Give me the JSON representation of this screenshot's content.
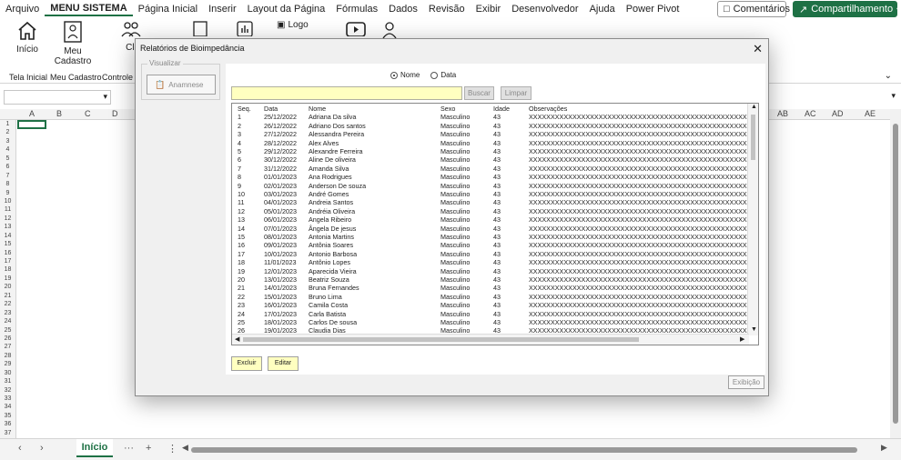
{
  "menu": [
    "Arquivo",
    "MENU SISTEMA",
    "Página Inicial",
    "Inserir",
    "Layout da Página",
    "Fórmulas",
    "Dados",
    "Revisão",
    "Exibir",
    "Desenvolvedor",
    "Ajuda",
    "Power Pivot"
  ],
  "menu_buttons": {
    "comments": "Comentários",
    "share": "Compartilhamento"
  },
  "ribbon": {
    "inicio": "Início",
    "meu": "Meu",
    "cadastro": "Cadastro",
    "cli": "Cli",
    "logo": "Logo",
    "groups": [
      "Tela Inicial",
      "Meu Cadastro",
      "Controle"
    ]
  },
  "columns": [
    "A",
    "B",
    "C",
    "D",
    "AB",
    "AC",
    "AD",
    "AE"
  ],
  "rows": [
    "1",
    "2",
    "3",
    "4",
    "5",
    "6",
    "7",
    "8",
    "9",
    "10",
    "11",
    "12",
    "13",
    "14",
    "15",
    "16",
    "17",
    "18",
    "19",
    "20",
    "21",
    "22",
    "23",
    "24",
    "25",
    "26",
    "27",
    "28",
    "29",
    "30",
    "31",
    "32",
    "33",
    "34",
    "35",
    "36",
    "37"
  ],
  "sheet": {
    "tab": "Início",
    "more": "···",
    "add": "+",
    "menu": "⋮"
  },
  "dialog": {
    "title": "Relatórios de Bioimpedância",
    "frame_title": "Visualizar",
    "anamnese": "Anamnese",
    "radio_nome": "Nome",
    "radio_data": "Data",
    "search_value": "",
    "buscar": "Buscar",
    "limpar": "Limpar",
    "headers": {
      "seq": "Seq.",
      "data": "Data",
      "nome": "Nome",
      "sexo": "Sexo",
      "idade": "Idade",
      "obs": "Observações"
    },
    "rows": [
      {
        "seq": "1",
        "data": "25/12/2022",
        "nome": "Adriana Da silva",
        "sexo": "Masculino",
        "idade": "43",
        "obs": "XXXXXXXXXXXXXXXXXXXXXXXXXXXXXXXXXXXXXXXXXXXXXXXXXX"
      },
      {
        "seq": "2",
        "data": "26/12/2022",
        "nome": "Adriano Dos santos",
        "sexo": "Masculino",
        "idade": "43",
        "obs": "XXXXXXXXXXXXXXXXXXXXXXXXXXXXXXXXXXXXXXXXXXXXXXXXXX"
      },
      {
        "seq": "3",
        "data": "27/12/2022",
        "nome": "Alessandra  Pereira",
        "sexo": "Masculino",
        "idade": "43",
        "obs": "XXXXXXXXXXXXXXXXXXXXXXXXXXXXXXXXXXXXXXXXXXXXXXXXXX"
      },
      {
        "seq": "4",
        "data": "28/12/2022",
        "nome": "Alex  Alves",
        "sexo": "Masculino",
        "idade": "43",
        "obs": "XXXXXXXXXXXXXXXXXXXXXXXXXXXXXXXXXXXXXXXXXXXXXXXXXX"
      },
      {
        "seq": "5",
        "data": "29/12/2022",
        "nome": "Alexandre  Ferreira",
        "sexo": "Masculino",
        "idade": "43",
        "obs": "XXXXXXXXXXXXXXXXXXXXXXXXXXXXXXXXXXXXXXXXXXXXXXXXXX"
      },
      {
        "seq": "6",
        "data": "30/12/2022",
        "nome": "Aline  De oliveira",
        "sexo": "Masculino",
        "idade": "43",
        "obs": "XXXXXXXXXXXXXXXXXXXXXXXXXXXXXXXXXXXXXXXXXXXXXXXXXX"
      },
      {
        "seq": "7",
        "data": "31/12/2022",
        "nome": "Amanda  Silva",
        "sexo": "Masculino",
        "idade": "43",
        "obs": "XXXXXXXXXXXXXXXXXXXXXXXXXXXXXXXXXXXXXXXXXXXXXXXXXX"
      },
      {
        "seq": "8",
        "data": "01/01/2023",
        "nome": "Ana  Rodrigues",
        "sexo": "Masculino",
        "idade": "43",
        "obs": "XXXXXXXXXXXXXXXXXXXXXXXXXXXXXXXXXXXXXXXXXXXXXXXXXX"
      },
      {
        "seq": "9",
        "data": "02/01/2023",
        "nome": "Anderson  De souza",
        "sexo": "Masculino",
        "idade": "43",
        "obs": "XXXXXXXXXXXXXXXXXXXXXXXXXXXXXXXXXXXXXXXXXXXXXXXXXX"
      },
      {
        "seq": "10",
        "data": "03/01/2023",
        "nome": "André  Gomes",
        "sexo": "Masculino",
        "idade": "43",
        "obs": "XXXXXXXXXXXXXXXXXXXXXXXXXXXXXXXXXXXXXXXXXXXXXXXXXX"
      },
      {
        "seq": "11",
        "data": "04/01/2023",
        "nome": "Andreia  Santos",
        "sexo": "Masculino",
        "idade": "43",
        "obs": "XXXXXXXXXXXXXXXXXXXXXXXXXXXXXXXXXXXXXXXXXXXXXXXXXX"
      },
      {
        "seq": "12",
        "data": "05/01/2023",
        "nome": "Andréia  Oliveira",
        "sexo": "Masculino",
        "idade": "43",
        "obs": "XXXXXXXXXXXXXXXXXXXXXXXXXXXXXXXXXXXXXXXXXXXXXXXXXX"
      },
      {
        "seq": "13",
        "data": "06/01/2023",
        "nome": "Angela  Ribeiro",
        "sexo": "Masculino",
        "idade": "43",
        "obs": "XXXXXXXXXXXXXXXXXXXXXXXXXXXXXXXXXXXXXXXXXXXXXXXXXX"
      },
      {
        "seq": "14",
        "data": "07/01/2023",
        "nome": "Ângela  De jesus",
        "sexo": "Masculino",
        "idade": "43",
        "obs": "XXXXXXXXXXXXXXXXXXXXXXXXXXXXXXXXXXXXXXXXXXXXXXXXXX"
      },
      {
        "seq": "15",
        "data": "08/01/2023",
        "nome": "Antonia  Martins",
        "sexo": "Masculino",
        "idade": "43",
        "obs": "XXXXXXXXXXXXXXXXXXXXXXXXXXXXXXXXXXXXXXXXXXXXXXXXXX"
      },
      {
        "seq": "16",
        "data": "09/01/2023",
        "nome": "Antônia  Soares",
        "sexo": "Masculino",
        "idade": "43",
        "obs": "XXXXXXXXXXXXXXXXXXXXXXXXXXXXXXXXXXXXXXXXXXXXXXXXXX"
      },
      {
        "seq": "17",
        "data": "10/01/2023",
        "nome": "Antonio  Barbosa",
        "sexo": "Masculino",
        "idade": "43",
        "obs": "XXXXXXXXXXXXXXXXXXXXXXXXXXXXXXXXXXXXXXXXXXXXXXXXXX"
      },
      {
        "seq": "18",
        "data": "11/01/2023",
        "nome": "Antônio  Lopes",
        "sexo": "Masculino",
        "idade": "43",
        "obs": "XXXXXXXXXXXXXXXXXXXXXXXXXXXXXXXXXXXXXXXXXXXXXXXXXX"
      },
      {
        "seq": "19",
        "data": "12/01/2023",
        "nome": "Aparecida  Vieira",
        "sexo": "Masculino",
        "idade": "43",
        "obs": "XXXXXXXXXXXXXXXXXXXXXXXXXXXXXXXXXXXXXXXXXXXXXXXXXX"
      },
      {
        "seq": "20",
        "data": "13/01/2023",
        "nome": "Beatriz  Souza",
        "sexo": "Masculino",
        "idade": "43",
        "obs": "XXXXXXXXXXXXXXXXXXXXXXXXXXXXXXXXXXXXXXXXXXXXXXXXXX"
      },
      {
        "seq": "21",
        "data": "14/01/2023",
        "nome": "Bruna  Fernandes",
        "sexo": "Masculino",
        "idade": "43",
        "obs": "XXXXXXXXXXXXXXXXXXXXXXXXXXXXXXXXXXXXXXXXXXXXXXXXXX"
      },
      {
        "seq": "22",
        "data": "15/01/2023",
        "nome": "Bruno  Lima",
        "sexo": "Masculino",
        "idade": "43",
        "obs": "XXXXXXXXXXXXXXXXXXXXXXXXXXXXXXXXXXXXXXXXXXXXXXXXXX"
      },
      {
        "seq": "23",
        "data": "16/01/2023",
        "nome": "Camila  Costa",
        "sexo": "Masculino",
        "idade": "43",
        "obs": "XXXXXXXXXXXXXXXXXXXXXXXXXXXXXXXXXXXXXXXXXXXXXXXXXX"
      },
      {
        "seq": "24",
        "data": "17/01/2023",
        "nome": "Carla  Batista",
        "sexo": "Masculino",
        "idade": "43",
        "obs": "XXXXXXXXXXXXXXXXXXXXXXXXXXXXXXXXXXXXXXXXXXXXXXXXXX"
      },
      {
        "seq": "25",
        "data": "18/01/2023",
        "nome": "Carlos  De sousa",
        "sexo": "Masculino",
        "idade": "43",
        "obs": "XXXXXXXXXXXXXXXXXXXXXXXXXXXXXXXXXXXXXXXXXXXXXXXXXX"
      },
      {
        "seq": "26",
        "data": "19/01/2023",
        "nome": "Claudia  Dias",
        "sexo": "Masculino",
        "idade": "43",
        "obs": "XXXXXXXXXXXXXXXXXXXXXXXXXXXXXXXXXXXXXXXXXXXXXXXXXX"
      }
    ],
    "excluir": "Excluir",
    "editar": "Editar",
    "exibicao": "Exibição"
  },
  "colors": {
    "accent": "#1e7145",
    "input_yellow": "#ffffc0"
  }
}
